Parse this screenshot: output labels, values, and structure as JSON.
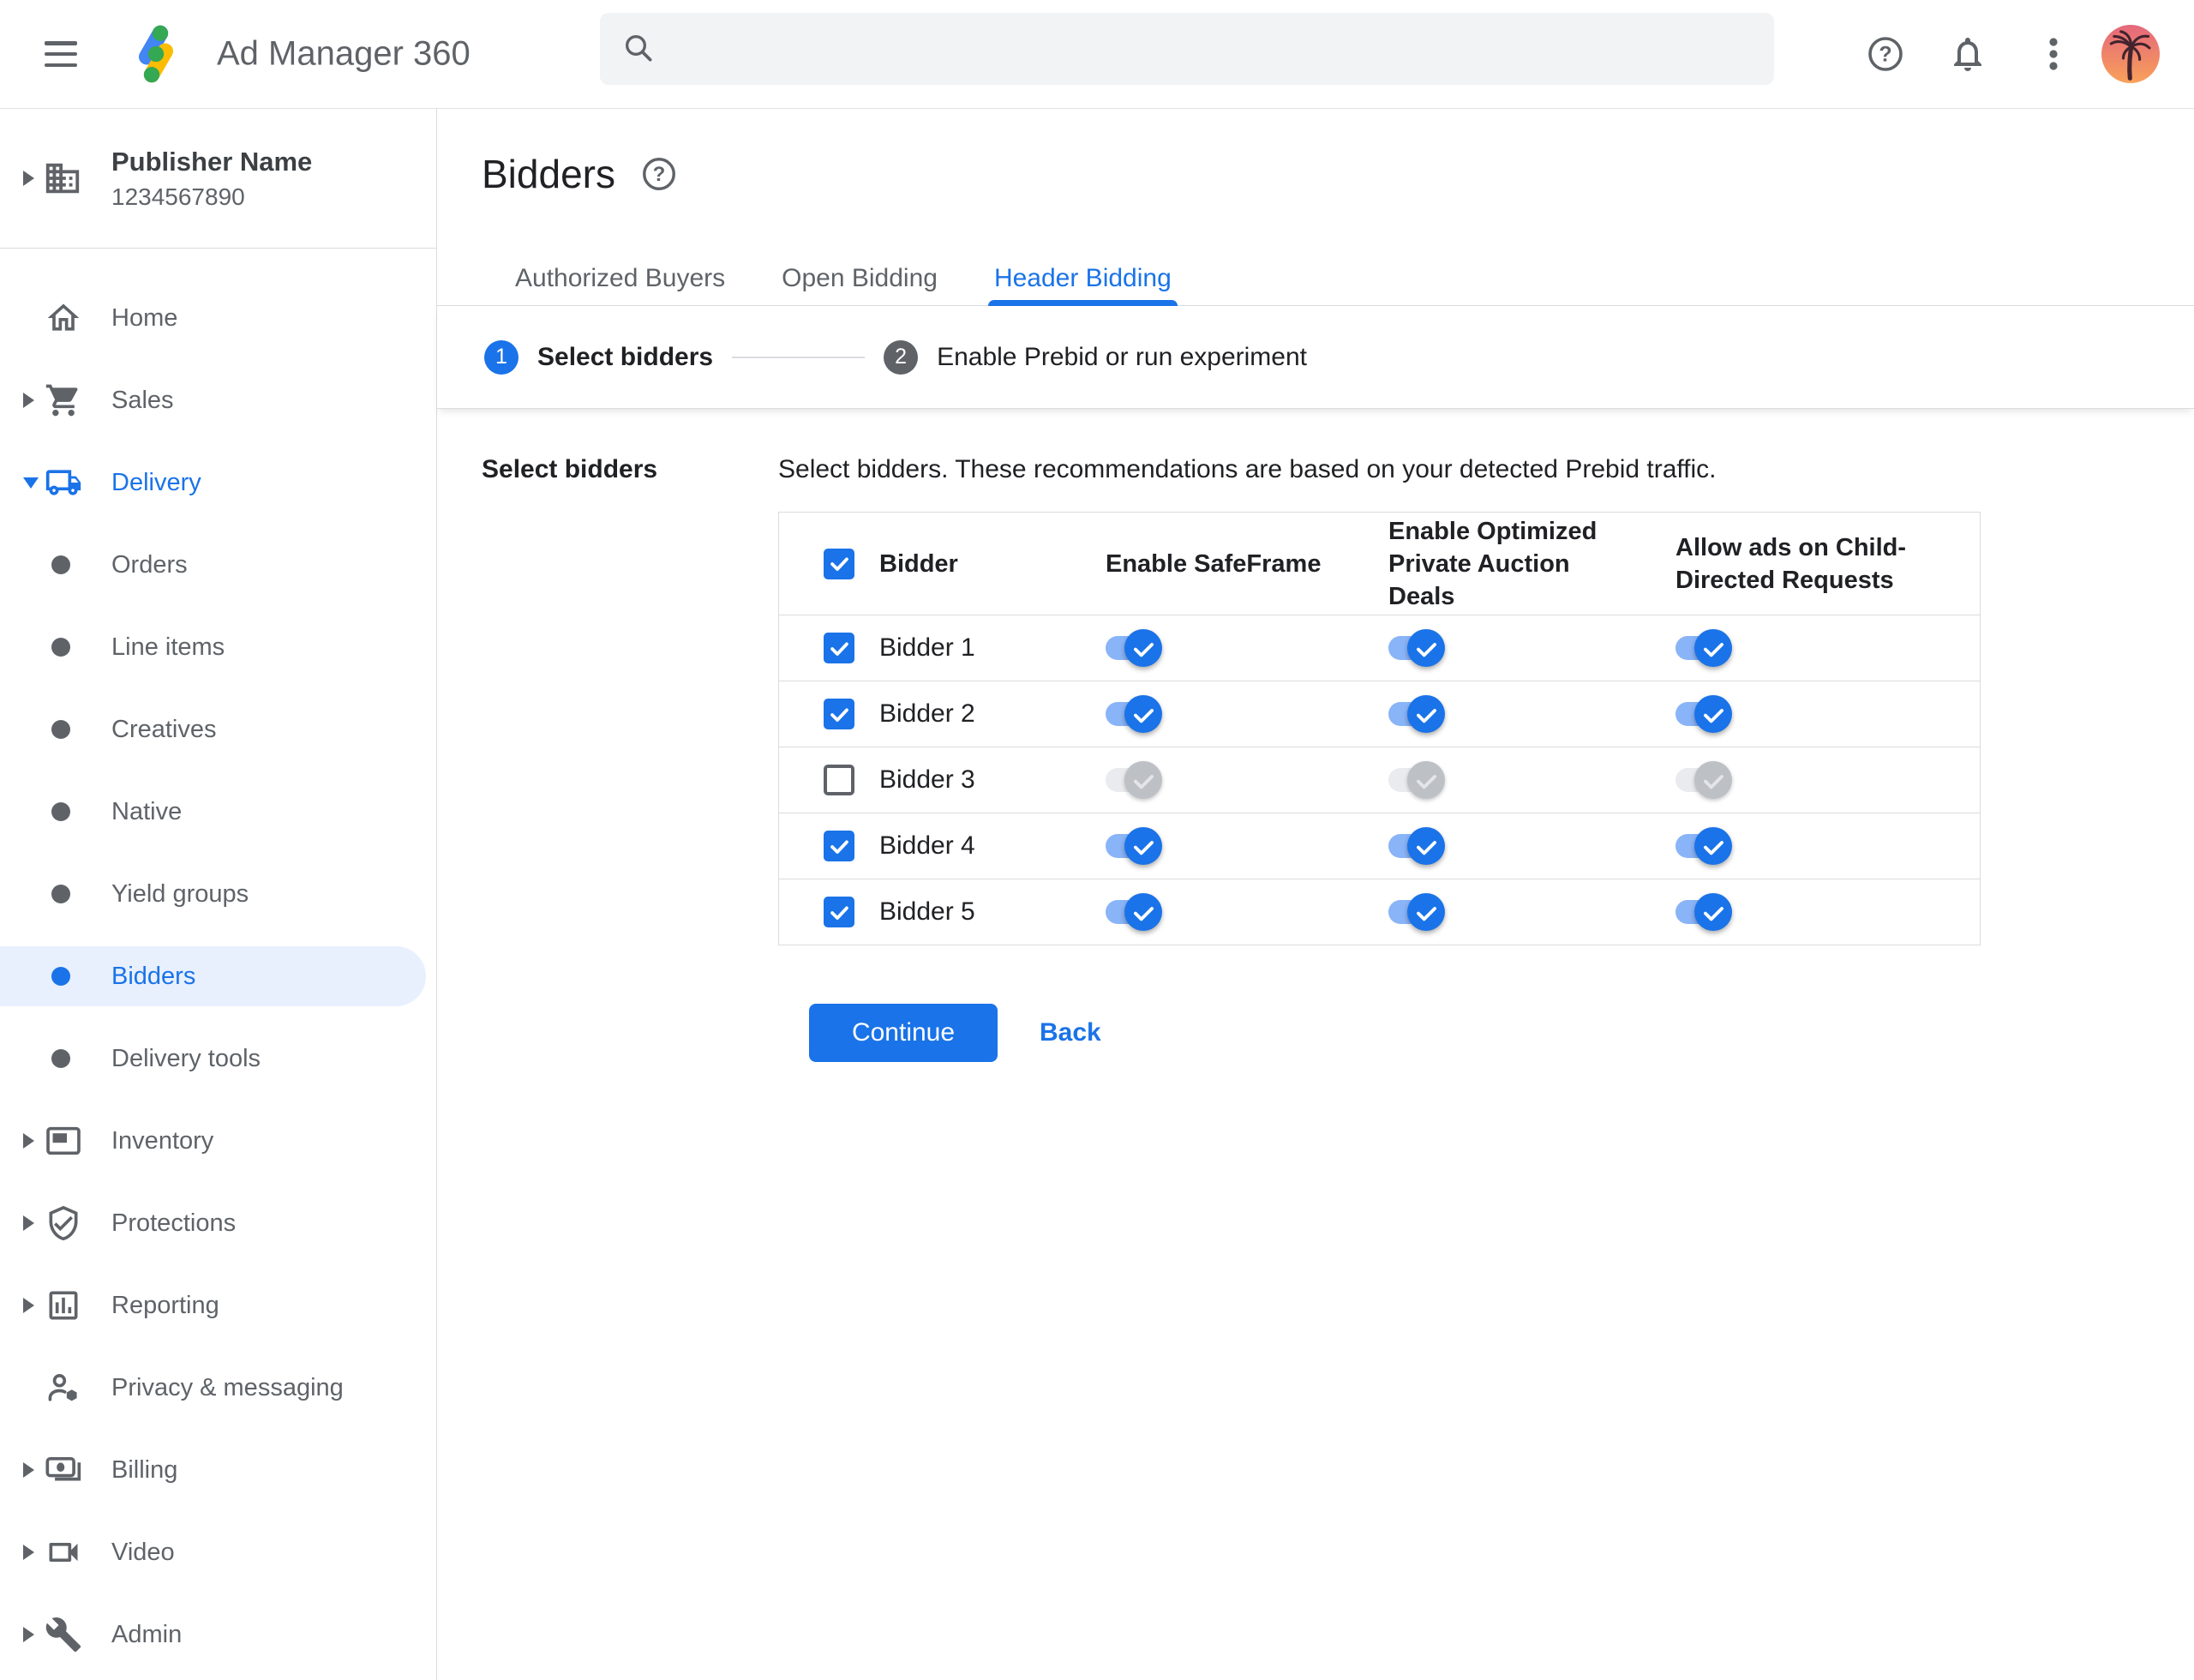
{
  "header": {
    "app_title": "Ad Manager 360",
    "search": {
      "value": "",
      "placeholder": ""
    },
    "icons": [
      "menu",
      "ad-manager-logo",
      "search",
      "help",
      "notifications",
      "more-vertical",
      "avatar"
    ]
  },
  "publisher": {
    "name": "Publisher Name",
    "id": "1234567890",
    "icon": "building"
  },
  "sidebar": {
    "items": [
      {
        "label": "Home",
        "icon": "home"
      },
      {
        "label": "Sales",
        "icon": "cart",
        "expandable": true
      },
      {
        "label": "Delivery",
        "icon": "truck",
        "expandable": true,
        "expanded": true,
        "active": true
      },
      {
        "label": "Orders",
        "icon": "bullet"
      },
      {
        "label": "Line items",
        "icon": "bullet"
      },
      {
        "label": "Creatives",
        "icon": "bullet"
      },
      {
        "label": "Native",
        "icon": "bullet"
      },
      {
        "label": "Yield groups",
        "icon": "bullet"
      },
      {
        "label": "Bidders",
        "icon": "bullet",
        "selected": true
      },
      {
        "label": "Delivery tools",
        "icon": "bullet"
      },
      {
        "label": "Inventory",
        "icon": "inventory",
        "expandable": true
      },
      {
        "label": "Protections",
        "icon": "shield-check",
        "expandable": true
      },
      {
        "label": "Reporting",
        "icon": "bar-chart",
        "expandable": true
      },
      {
        "label": "Privacy & messaging",
        "icon": "person-badge"
      },
      {
        "label": "Billing",
        "icon": "banknote",
        "expandable": true
      },
      {
        "label": "Video",
        "icon": "video-camera",
        "expandable": true
      },
      {
        "label": "Admin",
        "icon": "wrench",
        "expandable": true
      }
    ]
  },
  "page": {
    "title": "Bidders"
  },
  "tabs": [
    {
      "label": "Authorized Buyers",
      "active": false
    },
    {
      "label": "Open Bidding",
      "active": false
    },
    {
      "label": "Header Bidding",
      "active": true
    }
  ],
  "stepper": [
    {
      "number": "1",
      "label": "Select bidders",
      "active": true
    },
    {
      "number": "2",
      "label": "Enable Prebid or run experiment",
      "active": false
    }
  ],
  "content": {
    "section_label": "Select bidders",
    "description": "Select bidders. These recommendations are based on your detected Prebid traffic.",
    "table": {
      "columns": [
        "Bidder",
        "Enable SafeFrame",
        "Enable Optimized Private Auction Deals",
        "Allow ads on Child-Directed Requests"
      ],
      "header_checkbox_checked": true,
      "rows": [
        {
          "label": "Bidder 1",
          "selected": true,
          "toggles": {
            "safeframe": true,
            "optimized_deals": true,
            "child_directed": true
          }
        },
        {
          "label": "Bidder 2",
          "selected": true,
          "toggles": {
            "safeframe": true,
            "optimized_deals": true,
            "child_directed": true
          }
        },
        {
          "label": "Bidder 3",
          "selected": false,
          "toggles": {
            "safeframe": false,
            "optimized_deals": false,
            "child_directed": false
          }
        },
        {
          "label": "Bidder 4",
          "selected": true,
          "toggles": {
            "safeframe": true,
            "optimized_deals": true,
            "child_directed": true
          }
        },
        {
          "label": "Bidder 5",
          "selected": true,
          "toggles": {
            "safeframe": true,
            "optimized_deals": true,
            "child_directed": true
          }
        }
      ]
    },
    "continue_label": "Continue",
    "back_label": "Back"
  },
  "colors": {
    "accent_blue": "#1a73e8",
    "selected_item_bg": "#e8f0fe",
    "toggle_on_track": "#8ab4f8",
    "toggle_on_thumb": "#1a73e8",
    "toggle_off_track": "#e9ebee",
    "toggle_off_thumb": "#bdc1c6",
    "divider": "#dadce0",
    "text_primary": "#202124",
    "text_secondary": "#5f6368",
    "step_inactive": "#5f6368",
    "logo_blue": "#4285f4",
    "logo_yellow": "#fbbc04",
    "logo_green": "#34a853",
    "avatar_gradient_top": "#e4687c",
    "avatar_gradient_bottom": "#f9a25b"
  }
}
